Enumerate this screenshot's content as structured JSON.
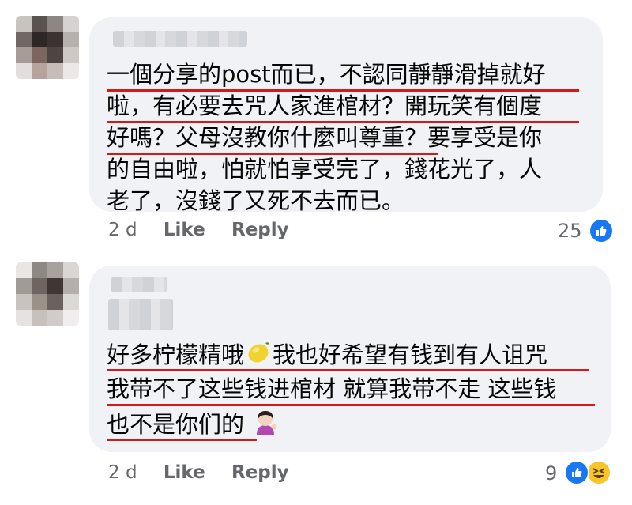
{
  "comments": [
    {
      "time": "2 d",
      "like_label": "Like",
      "reply_label": "Reply",
      "reaction_count": "25",
      "lines": [
        "一個分享的post而已，不認同靜靜滑掉就好",
        "啦，有必要去咒人家進棺材？開玩笑有個度",
        "好嗎？父母沒教你什麼叫尊重？要享受是你",
        "的自由啦，怕就怕享受完了，錢花光了，人",
        "老了，沒錢了又死不去而已。"
      ],
      "reactions": [
        "like-icon"
      ]
    },
    {
      "time": "2 d",
      "like_label": "Like",
      "reply_label": "Reply",
      "reaction_count": "9",
      "line1_a": "好多柠檬精哦",
      "line1_b": "我也好希望有钱到有人诅咒",
      "line2": "我带不了这些钱进棺材 就算我带不走 这些钱",
      "line3": "也不是你们的",
      "emojis": [
        "lemon-emoji",
        "woman-tipping-hand-emoji"
      ],
      "reactions": [
        "like-icon",
        "haha-icon"
      ]
    }
  ],
  "colors": {
    "bubble": "#f0f2f5",
    "underline": "#d11a1a",
    "meta": "#65676b",
    "like": "#1877f2"
  }
}
